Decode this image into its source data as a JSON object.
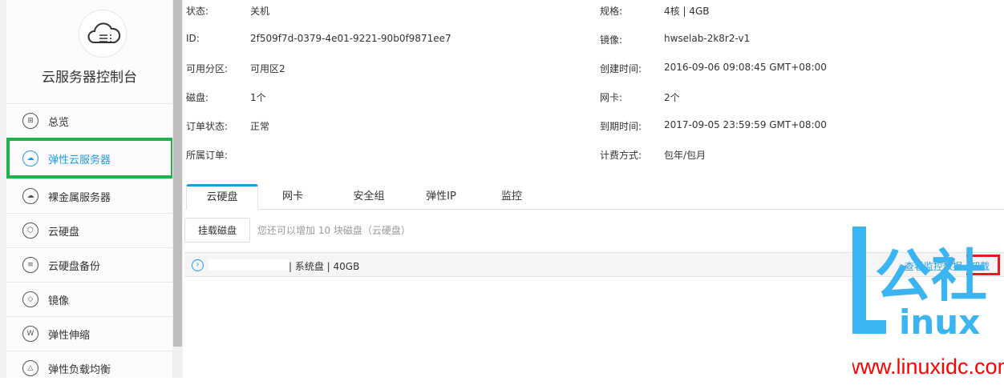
{
  "sidebar": {
    "title": "云服务器控制台",
    "items": [
      {
        "label": "总览",
        "icon": "grid-icon"
      },
      {
        "label": "弹性云服务器",
        "icon": "cloud-icon",
        "active": true
      },
      {
        "label": "裸金属服务器",
        "icon": "server-cloud-icon"
      },
      {
        "label": "云硬盘",
        "icon": "cube-icon"
      },
      {
        "label": "云硬盘备份",
        "icon": "backup-icon"
      },
      {
        "label": "镜像",
        "icon": "layers-icon"
      },
      {
        "label": "弹性伸缩",
        "icon": "scaling-icon"
      },
      {
        "label": "弹性负载均衡",
        "icon": "balance-icon"
      }
    ]
  },
  "info": {
    "left": [
      {
        "label": "状态:",
        "value": "关机"
      },
      {
        "label": "ID:",
        "value": "2f509f7d-0379-4e01-9221-90b0f9871ee7"
      },
      {
        "label": "可用分区:",
        "value": "可用区2"
      },
      {
        "label": "磁盘:",
        "value": "1个"
      },
      {
        "label": "订单状态:",
        "value": "正常"
      },
      {
        "label": "所属订单:",
        "value": ""
      }
    ],
    "right": [
      {
        "label": "规格:",
        "value": "4核 | 4GB"
      },
      {
        "label": "镜像:",
        "value": "hwselab-2k8r2-v1"
      },
      {
        "label": "创建时间:",
        "value": "2016-09-06 09:08:45 GMT+08:00"
      },
      {
        "label": "网卡:",
        "value": "2个"
      },
      {
        "label": "到期时间:",
        "value": "2017-09-05 23:59:59 GMT+08:00"
      },
      {
        "label": "计费方式:",
        "value": "包年/包月"
      }
    ]
  },
  "tabs": [
    "云硬盘",
    "网卡",
    "安全组",
    "弹性IP",
    "监控"
  ],
  "disk": {
    "attach_button": "挂载磁盘",
    "hint": "您还可以增加 10 块磁盘（云硬盘）",
    "row_info": "| 系统盘 | 40GB",
    "view_monitor": "查看监控数据",
    "unmount": "卸载"
  },
  "watermark": {
    "logo": "L公社 inux",
    "url": "www.linuxidc.com"
  },
  "colors": {
    "accent": "#1e9be8",
    "highlight": "#22b14c",
    "mark": "#e02020"
  }
}
